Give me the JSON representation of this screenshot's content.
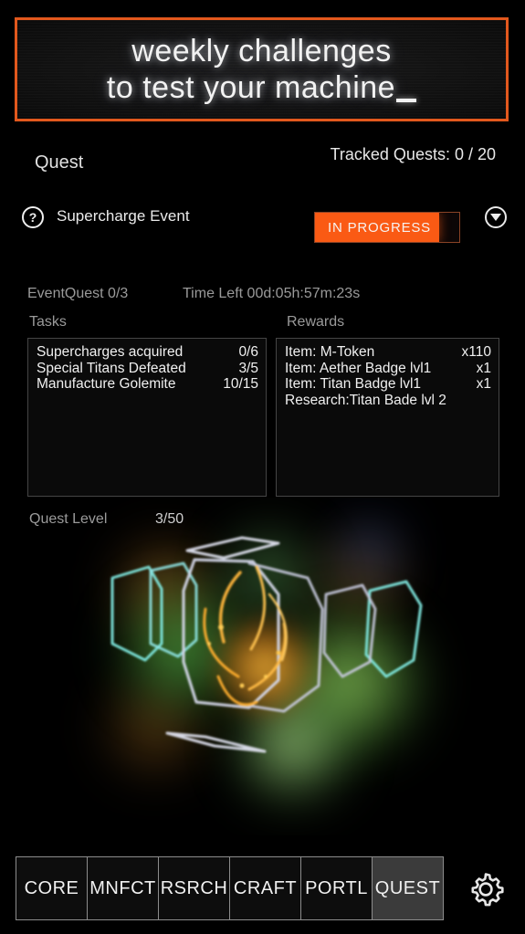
{
  "banner": {
    "line1": "weekly challenges",
    "line2": "to test your machine",
    "border_color": "#e2581d"
  },
  "header": {
    "title": "Quest",
    "tracked_quests": "Tracked Quests: 0 / 20"
  },
  "event": {
    "help_icon": "question-mark-icon",
    "name": "Supercharge Event",
    "status_label": "IN PROGRESS",
    "status_color": "#fa5a14",
    "expand_icon": "chevron-down-icon"
  },
  "meta": {
    "event_quest": "EventQuest  0/3",
    "time_left": "Time Left 00d:05h:57m:23s"
  },
  "sections": {
    "tasks_label": "Tasks",
    "rewards_label": "Rewards"
  },
  "tasks": [
    {
      "label": "Supercharges acquired",
      "value": "0/6"
    },
    {
      "label": "Special Titans Defeated",
      "value": "3/5"
    },
    {
      "label": "Manufacture Golemite",
      "value": "10/15"
    }
  ],
  "rewards": [
    {
      "label": "Item: M-Token",
      "value": "x110"
    },
    {
      "label": "Item: Aether Badge lvl1",
      "value": "x1"
    },
    {
      "label": "Item: Titan Badge lvl1",
      "value": "x1"
    },
    {
      "label": "Research:Titan Bade lvl 2",
      "value": ""
    }
  ],
  "quest_level": {
    "label": "Quest Level",
    "value": "3/50"
  },
  "artwork": {
    "name": "machine-nebula-graphic"
  },
  "nav": {
    "items": [
      {
        "label": "CORE",
        "active": false
      },
      {
        "label": "MNFCT",
        "active": false
      },
      {
        "label": "RSRCH",
        "active": false
      },
      {
        "label": "CRAFT",
        "active": false
      },
      {
        "label": "PORTL",
        "active": false
      },
      {
        "label": "QUEST",
        "active": true
      }
    ],
    "settings_icon": "gear-icon"
  }
}
